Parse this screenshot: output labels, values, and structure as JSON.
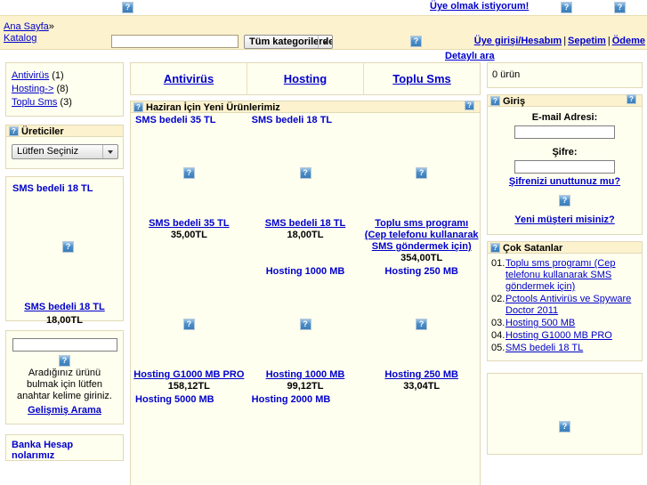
{
  "top": {
    "signup_label": "Üye olmak istiyorum!",
    "icon_left": "broken-image-icon",
    "icon_right_1": "broken-image-icon",
    "icon_right_2": "broken-image-icon"
  },
  "header": {
    "breadcrumb_home": "Ana Sayfa",
    "breadcrumb_sep": "»",
    "breadcrumb_current": "Katalog",
    "search_value": "",
    "search_placeholder": "",
    "category_select": "Tüm kategorilerde",
    "account_links": [
      "Üye girişi/Hesabım",
      "Sepetim",
      "Ödeme"
    ],
    "advanced_search": "Detaylı ara"
  },
  "sidebar_left": {
    "categories": [
      {
        "label": "Antivirüs",
        "count": "(1)"
      },
      {
        "label": "Hosting->",
        "count": "(8)"
      },
      {
        "label": "Toplu Sms",
        "count": "(3)"
      }
    ],
    "manufacturers": {
      "title": "Üreticiler",
      "selected": "Lütfen Seçiniz"
    },
    "special": {
      "title": "SMS bedeli 18 TL",
      "product_name": "SMS bedeli 18 TL",
      "price": "18,00TL"
    },
    "search": {
      "value": "",
      "hint": "Aradığınız ürünü bulmak için lütfen anahtar kelime giriniz.",
      "advanced_label": "Gelişmiş Arama"
    },
    "bank": {
      "title": "Banka Hesap nolarımız"
    }
  },
  "center": {
    "tabs": [
      {
        "label": "Antivirüs"
      },
      {
        "label": "Hosting"
      },
      {
        "label": "Toplu Sms"
      }
    ],
    "new_products_title": "Haziran İçin Yeni Ürünlerimiz",
    "rows": [
      {
        "cells": [
          {
            "top_label": "SMS bedeli 35 TL",
            "name": "SMS bedeli 35 TL",
            "price": "35,00TL"
          },
          {
            "top_label": "SMS bedeli 18 TL",
            "name": "SMS bedeli 18 TL",
            "price": "18,00TL"
          },
          {
            "top_label": "",
            "name": "Toplu sms programı (Cep telefonu kullanarak SMS göndermek için)",
            "price": "354,00TL"
          }
        ]
      },
      {
        "cells": [
          {
            "top_label": "",
            "name": "Hosting G1000 MB PRO",
            "price": "158,12TL"
          },
          {
            "top_label": "Hosting 1000 MB",
            "name": "Hosting 1000 MB",
            "price": "99,12TL"
          },
          {
            "top_label": "Hosting 250 MB",
            "name": "Hosting 250 MB",
            "price": "33,04TL"
          }
        ]
      },
      {
        "cells": [
          {
            "top_label": "Hosting 5000 MB",
            "name": "",
            "price": ""
          },
          {
            "top_label": "Hosting 2000 MB",
            "name": "",
            "price": ""
          },
          {
            "top_label": "",
            "name": "",
            "price": ""
          }
        ]
      }
    ]
  },
  "sidebar_right": {
    "cart": {
      "text": "0 ürün"
    },
    "login": {
      "title": "Giriş",
      "email_label": "E-mail Adresi:",
      "email_value": "",
      "password_label": "Şifre:",
      "password_value": "",
      "forgot_label": "Şifrenizi unuttunuz mu?",
      "new_customer_label": "Yeni müşteri misiniz?"
    },
    "bestsellers": {
      "title": "Çok Satanlar",
      "items": [
        {
          "num": "01.",
          "label": "Toplu sms programı (Cep telefonu kullanarak SMS göndermek için)"
        },
        {
          "num": "02.",
          "label": "Pctools Antivirüs ve Spyware Doctor 2011"
        },
        {
          "num": "03.",
          "label": "Hosting 500 MB"
        },
        {
          "num": "04.",
          "label": "Hosting G1000 MB PRO"
        },
        {
          "num": "05.",
          "label": "SMS bedeli 18 TL"
        }
      ]
    }
  },
  "colors": {
    "header_band": "#fcf2ce",
    "box_body": "#ffffef",
    "box_border": "#e1d9b8",
    "link": "#0000cc"
  }
}
